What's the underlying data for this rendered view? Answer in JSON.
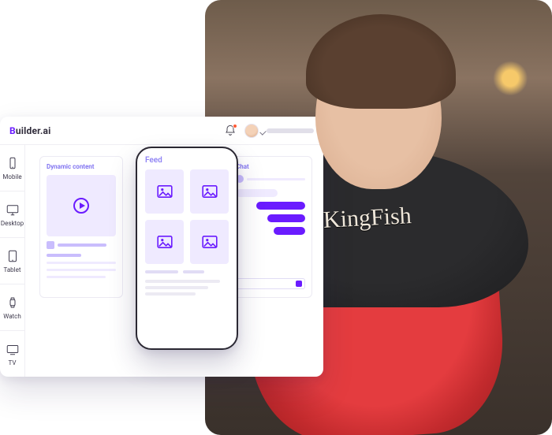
{
  "brand": {
    "prefix": "B",
    "rest": "uilder.ai"
  },
  "sidebar": {
    "items": [
      {
        "label": "Mobile",
        "icon": "mobile-icon"
      },
      {
        "label": "Desktop",
        "icon": "desktop-icon"
      },
      {
        "label": "Tablet",
        "icon": "tablet-icon"
      },
      {
        "label": "Watch",
        "icon": "watch-icon"
      },
      {
        "label": "TV",
        "icon": "tv-icon"
      }
    ]
  },
  "panels": {
    "content": {
      "title": "Dynamic content"
    },
    "feed": {
      "title": "Feed"
    },
    "chat": {
      "title": "Chat"
    }
  },
  "photo": {
    "tee_text": "KingFish"
  }
}
